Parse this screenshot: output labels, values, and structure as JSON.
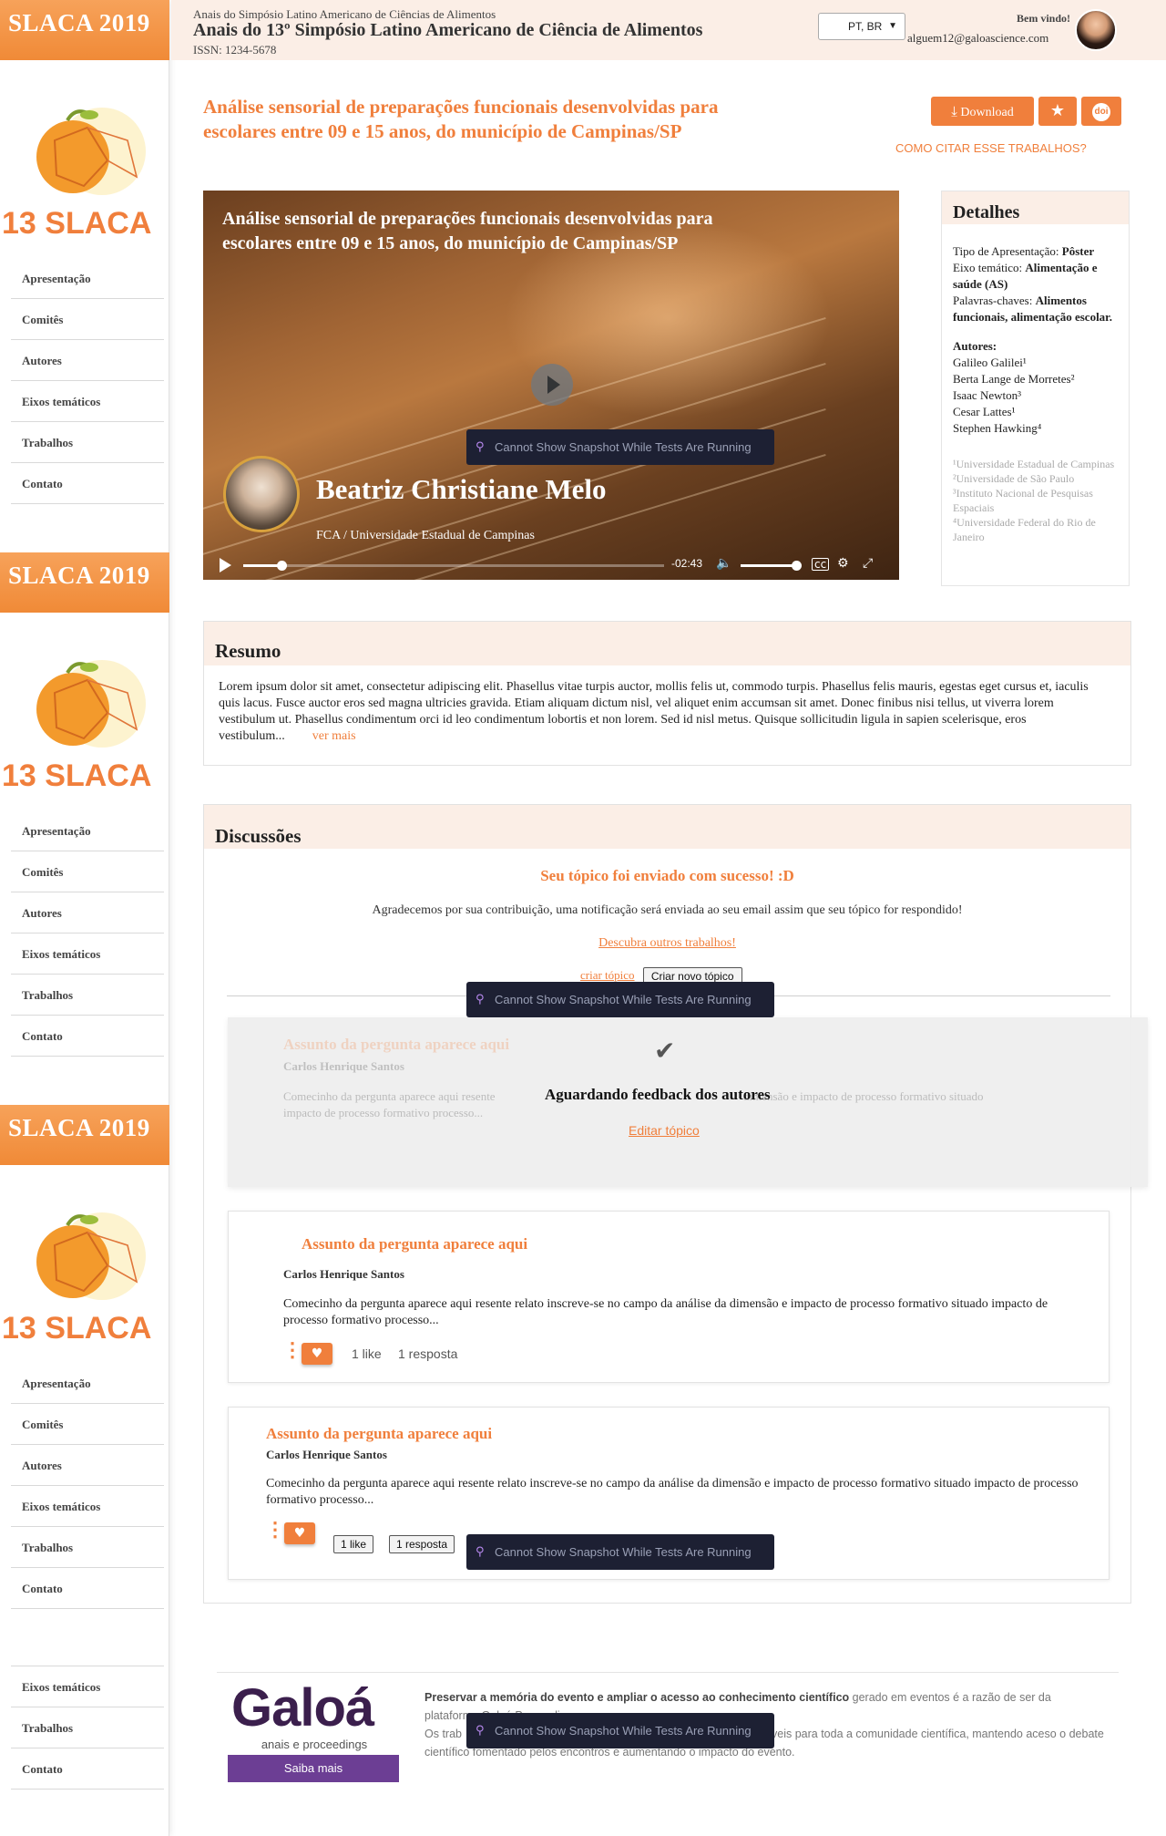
{
  "sidebar": {
    "banner": "SLACA 2019",
    "logo_text": "13 SLACA",
    "menu": [
      "Apresentação",
      "Comitês",
      "Autores",
      "Eixos temáticos",
      "Trabalhos",
      "Contato"
    ],
    "menu_extra": [
      "Eixos temáticos",
      "Trabalhos",
      "Contato"
    ]
  },
  "header": {
    "subtitle": "Anais do Simpósio Latino Americano de Ciências de Alimentos",
    "title": "Anais do 13º Simpósio Latino Americano de Ciência de Alimentos",
    "issn": "ISSN: 1234-5678",
    "language": "PT, BR",
    "welcome": "Bem vindo!",
    "email": "alguem12@galoascience.com"
  },
  "paper": {
    "title": "Análise sensorial de preparações funcionais desenvolvidas para escolares entre 09 e 15 anos, do município de Campinas/SP",
    "download_label": "Download",
    "doi_label": "doi",
    "cite_label": "COMO CITAR ESSE TRABALHOS?"
  },
  "video": {
    "title": "Análise sensorial de preparações funcionais desenvolvidas para escolares entre 09 e 15 anos, do município de Campinas/SP",
    "speaker_name": "Beatriz Christiane Melo",
    "speaker_institution": "FCA / Universidade Estadual de Campinas",
    "time_remaining": "-02:43",
    "progress": 0.09,
    "volume": 0.9
  },
  "details": {
    "heading": "Detalhes",
    "presentation_type_label": "Tipo de Apresentação:",
    "presentation_type": "Pôster",
    "axis_label": "Eixo temático:",
    "axis": "Alimentação e saúde (AS)",
    "keywords_label": "Palavras-chaves:",
    "keywords": "Alimentos funcionais, alimentação escolar.",
    "authors_label": "Autores:",
    "authors": [
      "Galileo Galilei¹",
      "Berta Lange de Morretes²",
      "Isaac Newton³",
      "Cesar Lattes¹",
      "Stephen Hawking⁴"
    ],
    "affiliations": [
      "¹Universidade Estadual de Campinas",
      "²Universidade de São Paulo",
      "³Instituto Nacional de Pesquisas Espaciais",
      "⁴Universidade Federal do Rio de Janeiro"
    ]
  },
  "resumo": {
    "heading": "Resumo",
    "text": "Lorem ipsum dolor sit amet, consectetur adipiscing elit. Phasellus vitae turpis auctor, mollis felis ut, commodo turpis. Phasellus felis mauris, egestas eget cursus et, iaculis quis lacus. Fusce auctor eros sed magna ultricies gravida. Etiam aliquam dictum nisl, vel aliquet enim accumsan sit amet. Donec finibus nisi tellus, ut viverra lorem vestibulum ut. Phasellus condimentum orci id leo condimentum lobortis et non lorem. Sed id nisl metus. Quisque sollicitudin ligula in sapien scelerisque, eros vestibulum...",
    "more_label": "ver mais"
  },
  "discussions": {
    "heading": "Discussões",
    "success_title": "Seu tópico foi enviado com sucesso! :D",
    "success_text": "Agradecemos por sua contribuição, uma notificação será enviada ao seu email assim que seu tópico for respondido!",
    "discover_link": "Descubra outros trabalhos!",
    "create_link": "criar tópico",
    "create_button": "Criar novo tópico",
    "pending": {
      "subject": "Assunto da pergunta aparece aqui",
      "author": "Carlos Henrique Santos",
      "text_left": "Comecinho da pergunta aparece aqui resente",
      "text_right": "dimensão e impacto de processo formativo situado",
      "text_line2": "impacto de processo formativo processo...",
      "status": "Aguardando feedback dos autores",
      "edit_link": "Editar tópico"
    },
    "questions": [
      {
        "subject": "Assunto da pergunta aparece aqui",
        "author": "Carlos Henrique Santos",
        "text": "Comecinho da pergunta aparece aqui resente relato inscreve-se no campo da análise da dimensão e impacto de processo formativo situado impacto de processo formativo processo...",
        "likes": "1 like",
        "replies": "1 resposta"
      },
      {
        "subject": "Assunto da pergunta aparece aqui",
        "author": "Carlos Henrique Santos",
        "text": "Comecinho da pergunta aparece aqui resente relato inscreve-se no campo da análise da dimensão e impacto de processo formativo situado impacto de processo formativo processo...",
        "likes": "1 like",
        "replies": "1 resposta"
      }
    ]
  },
  "toast": {
    "text": "Cannot Show Snapshot While Tests Are Running"
  },
  "footer": {
    "logo": "Galoá",
    "logo_sub": "anais e proceedings",
    "button": "Saiba mais",
    "text_bold": "Preservar a memória do evento e ampliar o acesso ao conhecimento científico",
    "text_1": " gerado em eventos é a razão de ser da plataforma Galoá Proceedings.",
    "text_2a": "Os trab",
    "text_2b": "veis para toda a comunidade científica, mantendo aceso o debate científico fomentado pelos encontros e aumentando o impacto do evento."
  },
  "colors": {
    "accent": "#f07f3c",
    "header_bg": "#fbeee6",
    "toast_bg": "#1d2033"
  }
}
